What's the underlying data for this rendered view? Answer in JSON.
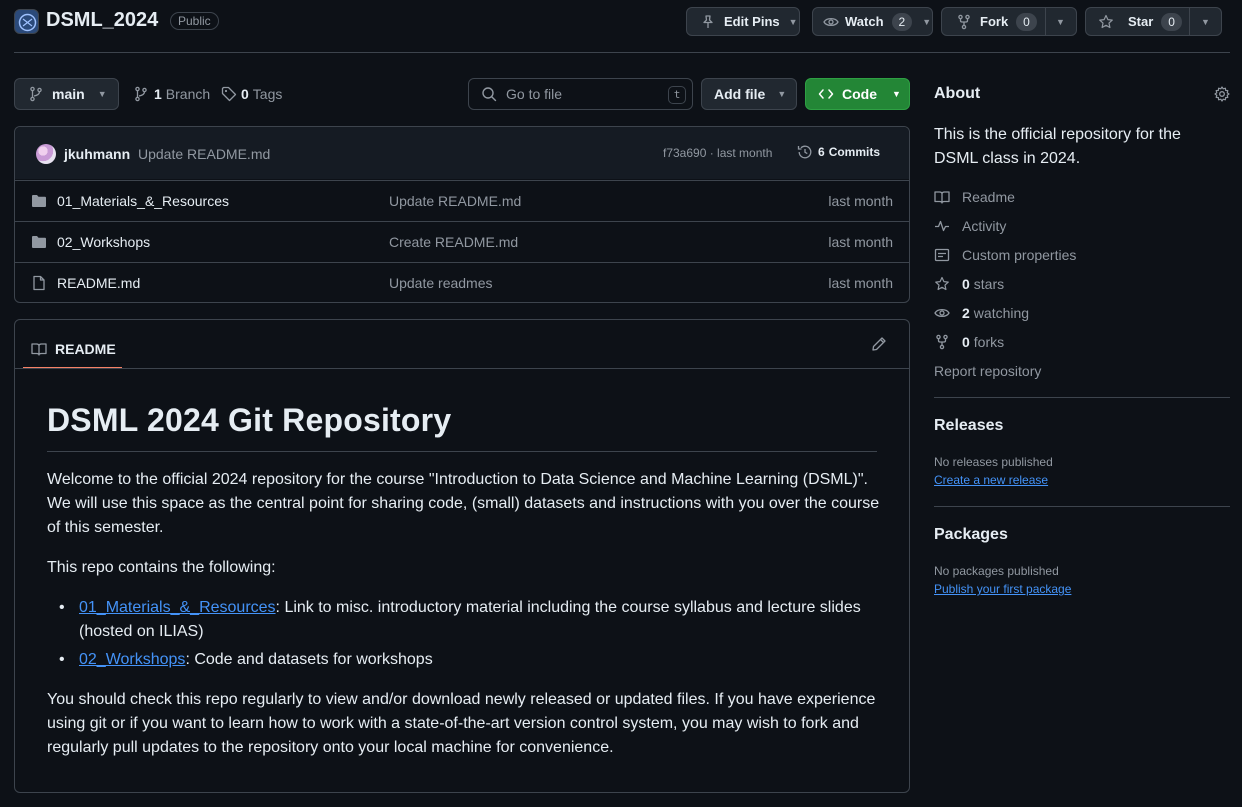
{
  "repo": {
    "name": "DSML_2024",
    "visibility": "Public"
  },
  "actions": {
    "edit_pins": "Edit Pins",
    "watch": "Watch",
    "watch_count": "2",
    "fork": "Fork",
    "fork_count": "0",
    "star": "Star",
    "star_count": "0"
  },
  "toolbar": {
    "branch": "main",
    "branch_count": "1",
    "branch_label": "Branch",
    "tags_count": "0",
    "tags_label": "Tags",
    "search_placeholder": "Go to file",
    "search_shortcut": "t",
    "add_file": "Add file",
    "code": "Code"
  },
  "commit": {
    "author": "jkuhmann",
    "message": "Update README.md",
    "hash_time": "f73a690 · last month",
    "commits_count": "6",
    "commits_label": "Commits"
  },
  "files": [
    {
      "name": "01_Materials_&_Resources",
      "message": "Update README.md",
      "time": "last month",
      "type": "folder"
    },
    {
      "name": "02_Workshops",
      "message": "Create README.md",
      "time": "last month",
      "type": "folder"
    },
    {
      "name": "README.md",
      "message": "Update readmes",
      "time": "last month",
      "type": "file"
    }
  ],
  "readme": {
    "tab": "README",
    "heading": "DSML 2024 Git Repository",
    "intro": "Welcome to the official 2024 repository for the course \"Introduction to Data Science and Machine Learning (DSML)\". We will use this space as the central point for sharing code, (small) datasets and instructions with you over the course of this semester.",
    "contains": "This repo contains the following:",
    "items": [
      {
        "link": "01_Materials_&_Resources",
        "text": ": Link to misc. introductory material including the course syllabus and lecture slides (hosted on ILIAS)"
      },
      {
        "link": "02_Workshops",
        "text": ": Code and datasets for workshops"
      }
    ],
    "outro": "You should check this repo regularly to view and/or download newly released or updated files. If you have experience using git or if you want to learn how to work with a state-of-the-art version control system, you may wish to fork and regularly pull updates to the repository onto your local machine for convenience."
  },
  "about": {
    "title": "About",
    "description": "This is the official repository for the DSML class in 2024.",
    "readme": "Readme",
    "activity": "Activity",
    "custom_properties": "Custom properties",
    "stars_count": "0",
    "stars_label": "stars",
    "watching_count": "2",
    "watching_label": "watching",
    "forks_count": "0",
    "forks_label": "forks",
    "report": "Report repository"
  },
  "releases": {
    "title": "Releases",
    "none": "No releases published",
    "create": "Create a new release"
  },
  "packages": {
    "title": "Packages",
    "none": "No packages published",
    "publish": "Publish your first package"
  },
  "colors": {
    "background": "#0d1117",
    "border": "#3d444d",
    "code_button": "#238636",
    "link": "#4493f8",
    "tab_underline": "#f78166"
  }
}
